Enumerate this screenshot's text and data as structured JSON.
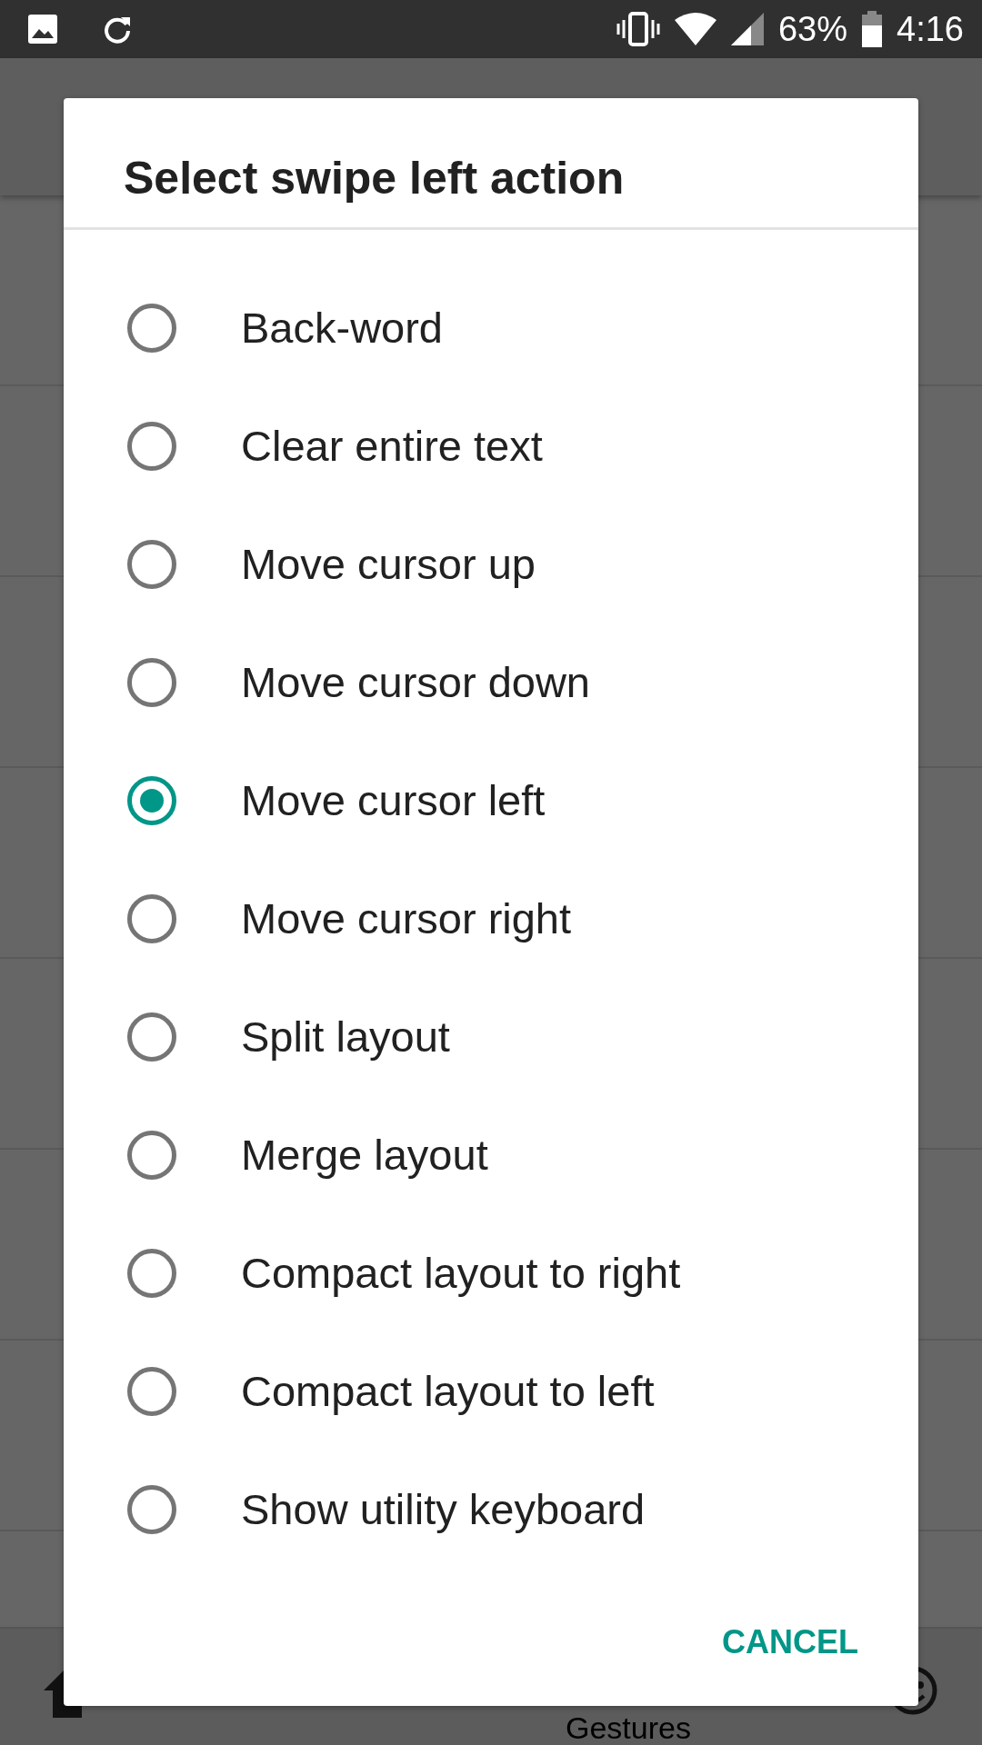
{
  "status_bar": {
    "battery": "63%",
    "time": "4:16"
  },
  "background": {
    "bottom_label": "Gestures"
  },
  "dialog": {
    "title": "Select swipe left action",
    "options": [
      {
        "label": "Back-word",
        "selected": false
      },
      {
        "label": "Clear entire text",
        "selected": false
      },
      {
        "label": "Move cursor up",
        "selected": false
      },
      {
        "label": "Move cursor down",
        "selected": false
      },
      {
        "label": "Move cursor left",
        "selected": true
      },
      {
        "label": "Move cursor right",
        "selected": false
      },
      {
        "label": "Split layout",
        "selected": false
      },
      {
        "label": "Merge layout",
        "selected": false
      },
      {
        "label": "Compact layout to right",
        "selected": false
      },
      {
        "label": "Compact layout to left",
        "selected": false
      },
      {
        "label": "Show utility keyboard",
        "selected": false
      }
    ],
    "cancel": "CANCEL"
  }
}
